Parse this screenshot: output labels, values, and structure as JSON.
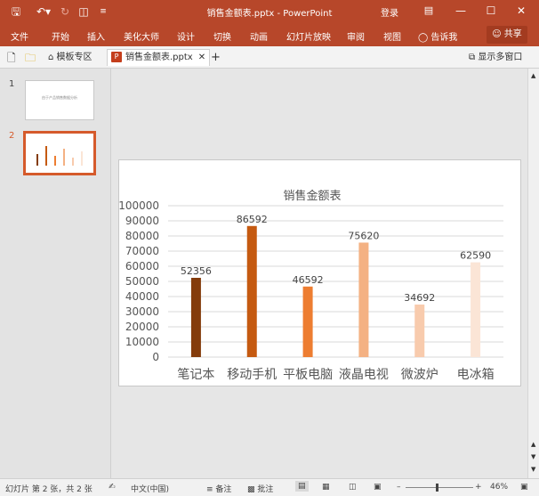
{
  "titlebar": {
    "doc_title": "销售金额表.pptx  -  PowerPoint",
    "login": "登录",
    "icons": [
      "save-icon",
      "undo-icon",
      "redo-icon",
      "presenter-icon",
      "customize-icon"
    ]
  },
  "ribbon": {
    "menus": [
      "文件",
      "开始",
      "插入",
      "美化大师",
      "设计",
      "切换",
      "动画",
      "幻灯片放映",
      "审阅",
      "视图",
      "告诉我"
    ],
    "share": "共享"
  },
  "tabs": {
    "template": "模板专区",
    "file": "销售金额表.pptx",
    "multi_window": "显示多窗口"
  },
  "slides": {
    "num1": "1",
    "num2": "2",
    "thumb1_text": "由于产品销售数据分析"
  },
  "chart_data": {
    "type": "bar",
    "title": "销售金额表",
    "categories": [
      "笔记本",
      "移动手机",
      "平板电脑",
      "液晶电视",
      "微波炉",
      "电冰箱"
    ],
    "values": [
      52356,
      86592,
      46592,
      75620,
      34692,
      62590
    ],
    "colors": [
      "#843c0c",
      "#c55a11",
      "#ed7d31",
      "#f4b183",
      "#f8cbad",
      "#fbe5d6"
    ],
    "ylim": [
      0,
      100000
    ],
    "yticks": [
      "0",
      "10000",
      "20000",
      "30000",
      "40000",
      "50000",
      "60000",
      "70000",
      "80000",
      "90000",
      "100000"
    ],
    "grid": true
  },
  "statusbar": {
    "slide_info": "幻灯片 第 2 张，共 2 张",
    "language": "中文(中国)",
    "notes": "备注",
    "comments": "批注",
    "zoom": "46%"
  }
}
